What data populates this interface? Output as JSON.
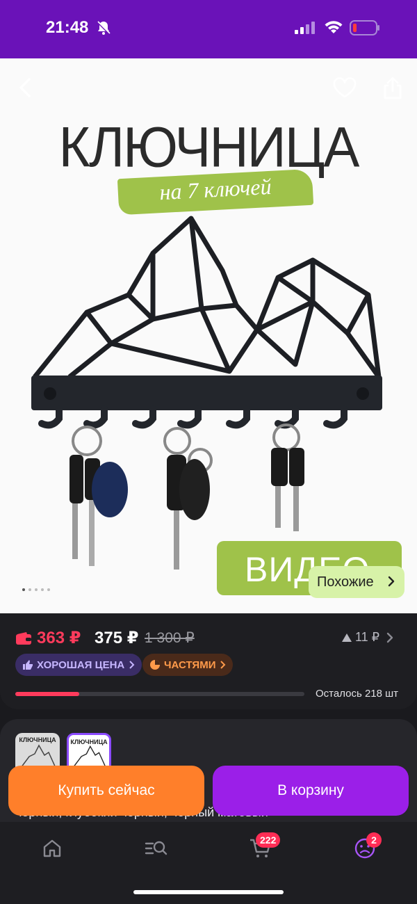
{
  "status_bar": {
    "time": "21:48"
  },
  "hero": {
    "title": "КЛЮЧНИЦА",
    "subtitle": "на 7 ключей",
    "video_label": "ВИДЕО",
    "similar_label": "Похожие"
  },
  "price": {
    "wallet_price": "363 ₽",
    "price": "375 ₽",
    "old_price": "1 300 ₽",
    "change": "11 ₽",
    "badges": {
      "good_price": "ХОРОШАЯ ЦЕНА",
      "installments": "ЧАСТЯМИ"
    },
    "stock_text": "Осталось 218 шт",
    "stock_progress": 0.22
  },
  "variants": {
    "thumb1_text": "КЛЮЧНИЦА",
    "thumb2_text": "КЛЮЧНИЦА",
    "colors_text": "черный, глубокий черный, черный матовый"
  },
  "actions": {
    "buy_now": "Купить сейчас",
    "add_to_cart": "В корзину"
  },
  "tabbar": {
    "cart_count": "222",
    "profile_count": "2"
  },
  "colors": {
    "brand": "#6a12b8",
    "accent_orange": "#ff7f2a",
    "accent_purple": "#9b1fe8",
    "price_red": "#ff3b5c"
  }
}
